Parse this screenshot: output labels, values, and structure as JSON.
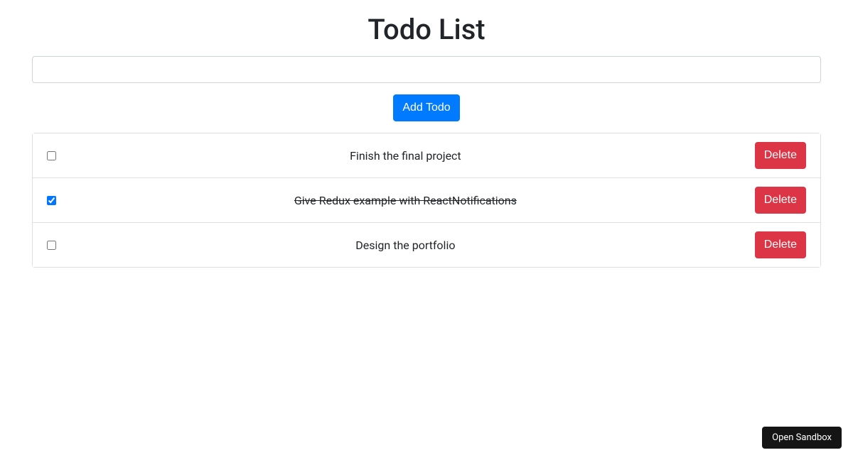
{
  "title": "Todo List",
  "input": {
    "value": "",
    "placeholder": ""
  },
  "addButtonLabel": "Add Todo",
  "deleteButtonLabel": "Delete",
  "todos": [
    {
      "text": "Finish the final project",
      "completed": false
    },
    {
      "text": "Give Redux example with ReactNotifications",
      "completed": true
    },
    {
      "text": "Design the portfolio",
      "completed": false
    }
  ],
  "sandboxButtonLabel": "Open Sandbox"
}
